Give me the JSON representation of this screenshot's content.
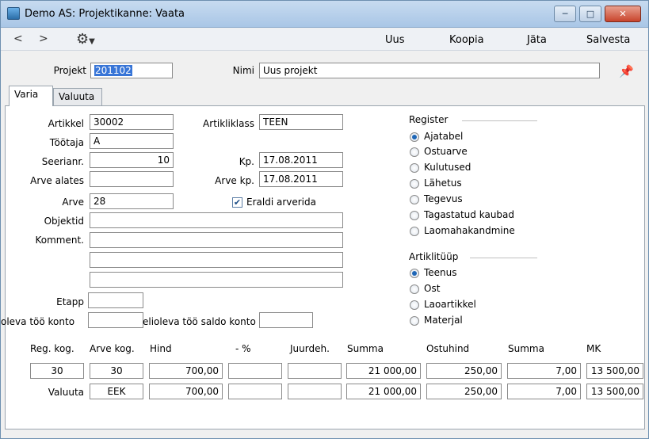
{
  "window": {
    "title": "Demo AS: Projektikanne: Vaata"
  },
  "toolbar": {
    "back": "<",
    "forward": ">",
    "uus": "Uus",
    "koopia": "Koopia",
    "jata": "Jäta",
    "salvesta": "Salvesta"
  },
  "header": {
    "projekt_label": "Projekt",
    "projekt_value": "201102",
    "nimi_label": "Nimi",
    "nimi_value": "Uus projekt"
  },
  "tabs": [
    "Varia",
    "Valuuta"
  ],
  "form": {
    "artikkel_label": "Artikkel",
    "artikkel_value": "30002",
    "artikliklass_label": "Artikliklass",
    "artikliklass_value": "TEEN",
    "tootaja_label": "Töötaja",
    "tootaja_value": "A",
    "seerianr_label": "Seerianr.",
    "seerianr_value": "10",
    "kp_label": "Kp.",
    "kp_value": "17.08.2011",
    "arve_alates_label": "Arve alates",
    "arve_alates_value": "",
    "arve_kp_label": "Arve kp.",
    "arve_kp_value": "17.08.2011",
    "arve_label": "Arve",
    "arve_value": "28",
    "eraldi_label": "Eraldi arverida",
    "objektid_label": "Objektid",
    "komment_label": "Komment.",
    "etapp_label": "Etapp",
    "poolelioleva_label": "oleva töö konto",
    "saldo_label": "elioleva töö saldo konto"
  },
  "register": {
    "title": "Register",
    "options": [
      "Ajatabel",
      "Ostuarve",
      "Kulutused",
      "Lähetus",
      "Tegevus",
      "Tagastatud kaubad",
      "Laomahakandmine"
    ],
    "selected_index": 0
  },
  "artiklituup": {
    "title": "Artiklitüüp",
    "options": [
      "Teenus",
      "Ost",
      "Laoartikkel",
      "Materjal"
    ],
    "selected_index": 0
  },
  "grid": {
    "headers": [
      "Reg. kog.",
      "Arve kog.",
      "Hind",
      "- %",
      "Juurdeh.",
      "Summa",
      "Ostuhind",
      "Summa",
      "MK"
    ],
    "row1": [
      "30",
      "30",
      "700,00",
      "",
      "",
      "21 000,00",
      "250,00",
      "7,00",
      "13 500,00"
    ],
    "row2_label": "Valuuta",
    "row2": [
      "EEK",
      "700,00",
      "",
      "",
      "21 000,00",
      "250,00",
      "7,00",
      "13 500,00"
    ]
  }
}
